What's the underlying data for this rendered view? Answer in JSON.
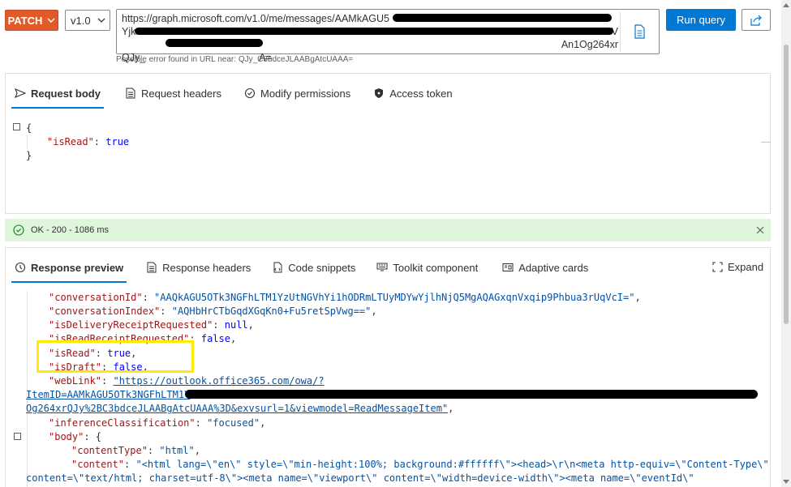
{
  "query": {
    "method": "PATCH",
    "version": "v1.0",
    "url_line1": "https://graph.microsoft.com/v1.0/me/messages/AAMkAGU5",
    "url_line2_start": "Yjk",
    "url_line2_end": "V",
    "url_line3_end": "An1Og264xr",
    "url_line4_start": "QJy_",
    "url_line4_end": "A=",
    "error_hint": "Possible error found in URL near: QJy_C3bdceJLAABgAtcUAAA=",
    "run_label": "Run query"
  },
  "request": {
    "tabs": [
      {
        "label": "Request body",
        "icon": "send-icon",
        "active": true
      },
      {
        "label": "Request headers",
        "icon": "document-icon",
        "active": false
      },
      {
        "label": "Modify permissions",
        "icon": "shield-check-icon",
        "active": false
      },
      {
        "label": "Access token",
        "icon": "lock-icon",
        "active": false
      }
    ],
    "body_lines": [
      "{",
      "\"isRead\"",
      ": ",
      "true",
      "}"
    ]
  },
  "status": {
    "text": "OK - 200 - 1086 ms",
    "color": "#dff6dd"
  },
  "response": {
    "tabs": [
      {
        "label": "Response preview",
        "icon": "eye-icon",
        "active": true
      },
      {
        "label": "Response headers",
        "icon": "document-icon",
        "active": false
      },
      {
        "label": "Code snippets",
        "icon": "code-file-icon",
        "active": false
      },
      {
        "label": "Toolkit component",
        "icon": "toolkit-icon",
        "active": false
      },
      {
        "label": "Adaptive cards",
        "icon": "card-icon",
        "active": false
      }
    ],
    "expand_label": "Expand",
    "lines": {
      "conversationId_key": "\"conversationId\"",
      "conversationId_val": "\"AAQkAGU5OTk3NGFhLTM1YzUtNGVhYi1hODRmLTUyMDYwYjlhNjQ5MgAQAGxqnVxqip9Phbua3rUqVcI=\"",
      "conversationIndex_key": "\"conversationIndex\"",
      "conversationIndex_val": "\"AQHbHrCTbGqdXGqKn0+Fu5retSpVwg==\"",
      "isDeliveryReceiptRequested_key": "\"isDeliveryReceiptRequested\"",
      "isDeliveryReceiptRequested_val": "null",
      "isReadReceiptRequested_key": "\"isReadReceiptRequested\"",
      "isReadReceiptRequested_val": "false",
      "isRead_key": "\"isRead\"",
      "isRead_val": "true",
      "isDraft_key": "\"isDraft\"",
      "isDraft_val": "false",
      "webLink_key": "\"webLink\"",
      "webLink_val1": "\"https://outlook.office365.com/owa/?",
      "webLink_val2": "ItemID=AAMkAGU5OTk3NGFhLTM1Y",
      "webLink_val3": "Og264xrQJy%2BC3bdceJLAABgAtcUAAA%3D&exvsurl=1&viewmodel=ReadMessageItem\"",
      "inferenceClassification_key": "\"inferenceClassification\"",
      "inferenceClassification_val": "\"focused\"",
      "body_key": "\"body\"",
      "contentType_key": "\"contentType\"",
      "contentType_val": "\"html\"",
      "content_key": "\"content\"",
      "content_val1": "\"<html lang=\\\"en\\\" style=\\\"min-height:100%; background:#ffffff\\\"><head>\\r\\n<meta http-equiv=\\\"Content-Type\\\"",
      "content_val2": "content=\\\"text/html; charset=utf-8\\\"><meta name=\\\"viewport\\\" content=\\\"width=device-width\\\"><meta name=\\\"eventId\\\""
    }
  }
}
